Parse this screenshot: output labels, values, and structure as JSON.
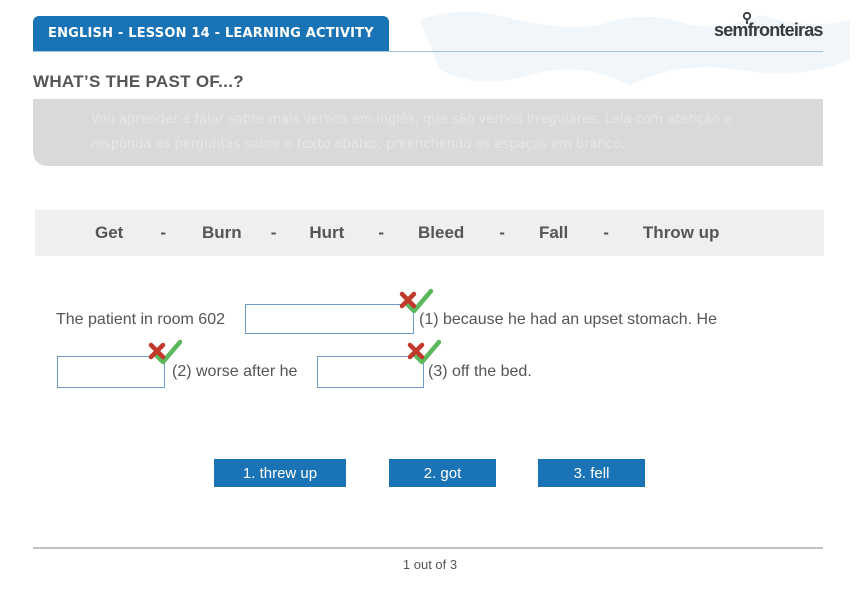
{
  "header": {
    "title": "ENGLISH - LESSON 14 - LEARNING ACTIVITY",
    "logo_text": "semfronteiras"
  },
  "activity": {
    "title": "WHAT’S THE PAST OF...?",
    "instruction_line1": "Vou aprender a falar sobre mais verbos em inglês, que são verbos irregulares. Leia com atenção e",
    "instruction_line2": "responda as perguntas sobre o texto abaixo, preenchendo os espaços em branco."
  },
  "verbs": [
    "Get",
    "Burn",
    "Hurt",
    "Bleed",
    "Fall",
    "Throw up"
  ],
  "verb_separator": "-",
  "sentence": {
    "part1": "The patient in room 602",
    "part2": "(1) because he had an upset stomach. He",
    "part3": "(2) worse  after he",
    "part4": "(3) off the bed."
  },
  "blanks": [
    {
      "value": ""
    },
    {
      "value": ""
    },
    {
      "value": ""
    }
  ],
  "answers": [
    "1. threw up",
    "2. got",
    "3. fell"
  ],
  "pagination": "1 out of 3",
  "colors": {
    "primary": "#1a73b4",
    "wrong_mark": "#c0392b",
    "correct_mark": "#5cb85c"
  },
  "icons": {
    "wrong": "cross-icon",
    "correct": "checkmark-icon"
  }
}
